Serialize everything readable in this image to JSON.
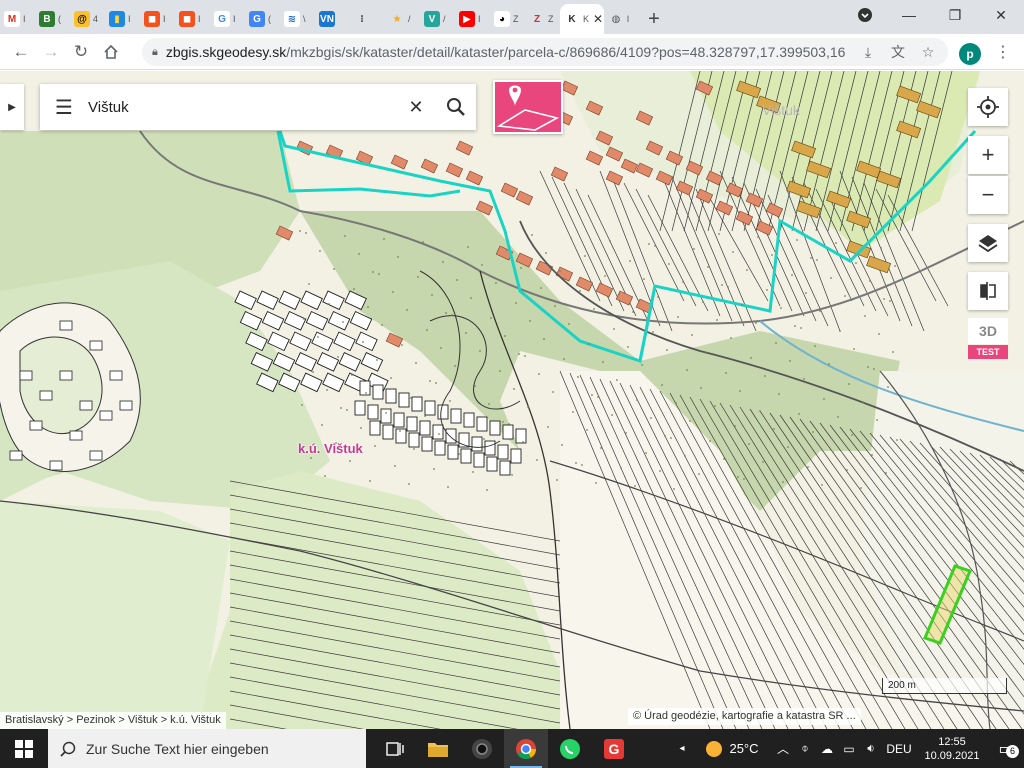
{
  "browser": {
    "tabs": [
      {
        "icon": "gmail-icon",
        "letter": "M",
        "color": "#ffffff",
        "fg": "#d93025",
        "title": "I"
      },
      {
        "icon": "b-app-icon",
        "letter": "B",
        "color": "#2e7d32",
        "fg": "#ffffff",
        "title": "("
      },
      {
        "icon": "at-icon",
        "letter": "@",
        "color": "#fbc02d",
        "fg": "#000000",
        "title": "4"
      },
      {
        "icon": "bag-icon",
        "letter": "▮",
        "color": "#1e88e5",
        "fg": "#fdd835",
        "title": "I"
      },
      {
        "icon": "shield-icon-1",
        "letter": "◼",
        "color": "#f4511e",
        "fg": "#ffffff",
        "title": "I"
      },
      {
        "icon": "shield-icon-2",
        "letter": "◼",
        "color": "#f4511e",
        "fg": "#ffffff",
        "title": "I"
      },
      {
        "icon": "google-icon",
        "letter": "G",
        "color": "#ffffff",
        "fg": "#4285f4",
        "title": "I"
      },
      {
        "icon": "translate-icon",
        "letter": "G",
        "color": "#4285f4",
        "fg": "#ffffff",
        "title": "("
      },
      {
        "icon": "wave-icon",
        "letter": "≋",
        "color": "#ffffff",
        "fg": "#1565c0",
        "title": "\\"
      },
      {
        "icon": "zoom-icon",
        "letter": "VN",
        "color": "#1976d2",
        "fg": "#ffffff",
        "title": ""
      },
      {
        "icon": "dots-icon",
        "letter": "⁝",
        "color": "#dee1e6",
        "fg": "#555555",
        "title": ""
      },
      {
        "icon": "star-icon",
        "letter": "★",
        "color": "#dee1e6",
        "fg": "#f9a825",
        "title": "/"
      },
      {
        "icon": "v-icon",
        "letter": "V",
        "color": "#26a69a",
        "fg": "#ffffff",
        "title": "/"
      },
      {
        "icon": "youtube-icon",
        "letter": "▶",
        "color": "#ff0000",
        "fg": "#ffffff",
        "title": "I"
      },
      {
        "icon": "panda-icon",
        "letter": "◕",
        "color": "#ffffff",
        "fg": "#000000",
        "title": "Z"
      },
      {
        "icon": "z-icon",
        "letter": "Z",
        "color": "#dee1e6",
        "fg": "#d32f2f",
        "title": "Z"
      }
    ],
    "active_tab": {
      "icon": "kataster-icon",
      "letter": "K",
      "title": "K"
    },
    "after_tab": {
      "icon": "globe-icon",
      "letter": "◍",
      "title": "l"
    },
    "new_tab": "+",
    "url_host": "zbgis.skgeodesy.sk",
    "url_path": "/mkzbgis/sk/kataster/detail/kataster/parcela-c/869686/4109?pos=48.328797,17.399503,16",
    "avatar_letter": "p"
  },
  "map": {
    "search_value": "Vištuk",
    "area_label": "k.ú. Vištuk",
    "village_label": "Vištuk",
    "scale_label": "200 m",
    "breadcrumb": "Bratislavský > Pezinok > Vištuk > k.ú. Vištuk",
    "attribution": "© Úrad geodézie, kartografie a katastra SR ...",
    "btn_3d": "3D",
    "test_badge": "TEST",
    "colors": {
      "boundary": "#19d3c5",
      "selection": "#3ad11e",
      "accent": "#e8467c",
      "building": "#e08a6a"
    }
  },
  "taskbar": {
    "search_placeholder": "Zur Suche Text hier eingeben",
    "temperature": "25°C",
    "language": "DEU",
    "time": "12:55",
    "date": "10.09.2021",
    "notifications": "6"
  }
}
